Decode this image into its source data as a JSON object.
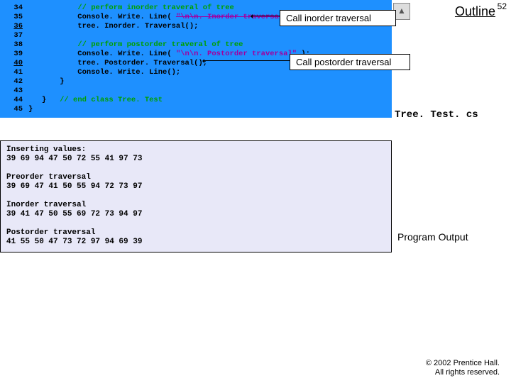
{
  "slide_number": "52",
  "outline_label": "Outline",
  "callouts": {
    "inorder": "Call inorder traversal",
    "postorder": "Call postorder traversal"
  },
  "filename": "Tree. Test. cs",
  "code": {
    "lines": [
      {
        "n": "34",
        "ind": "           ",
        "comment": "// perform inorder traveral of tree"
      },
      {
        "n": "35",
        "ind": "           ",
        "call": "Console. Write. Line( ",
        "str": "\"\\n\\n. Inorder traversal\"",
        "tail": " );"
      },
      {
        "n": "36",
        "ind": "           ",
        "plain": "tree. Inorder. Traversal();"
      },
      {
        "n": "37",
        "ind": "",
        "plain": ""
      },
      {
        "n": "38",
        "ind": "           ",
        "comment": "// perform postorder traveral of tree"
      },
      {
        "n": "39",
        "ind": "           ",
        "call": "Console. Write. Line( ",
        "str2": "\"\\n\\n. Postorder traversal\"",
        "tail": " );"
      },
      {
        "n": "40",
        "ind": "           ",
        "plain": "tree. Postorder. Traversal();"
      },
      {
        "n": "41",
        "ind": "           ",
        "plain": "Console. Write. Line();"
      },
      {
        "n": "42",
        "ind": "       ",
        "plain": "}"
      },
      {
        "n": "43",
        "ind": "",
        "plain": ""
      },
      {
        "n": "44",
        "ind": "   ",
        "plain": "}   ",
        "comment": "// end class Tree. Test"
      },
      {
        "n": "45",
        "ind": "",
        "plain": "}"
      }
    ]
  },
  "output": {
    "insert_h": "Inserting values:",
    "insert_v": "39 69 94 47 50 72 55 41 97 73",
    "pre_h": "Preorder traversal",
    "pre_v": "39 69 47 41 50 55 94 72 73 97",
    "in_h": "Inorder traversal",
    "in_v": "39 41 47 50 55 69 72 73 94 97",
    "post_h": "Postorder traversal",
    "post_v": "41 55 50 47 73 72 97 94 69 39"
  },
  "program_output_label": "Program Output",
  "footer": {
    "l1": "© 2002 Prentice Hall.",
    "l2": "All rights reserved."
  }
}
